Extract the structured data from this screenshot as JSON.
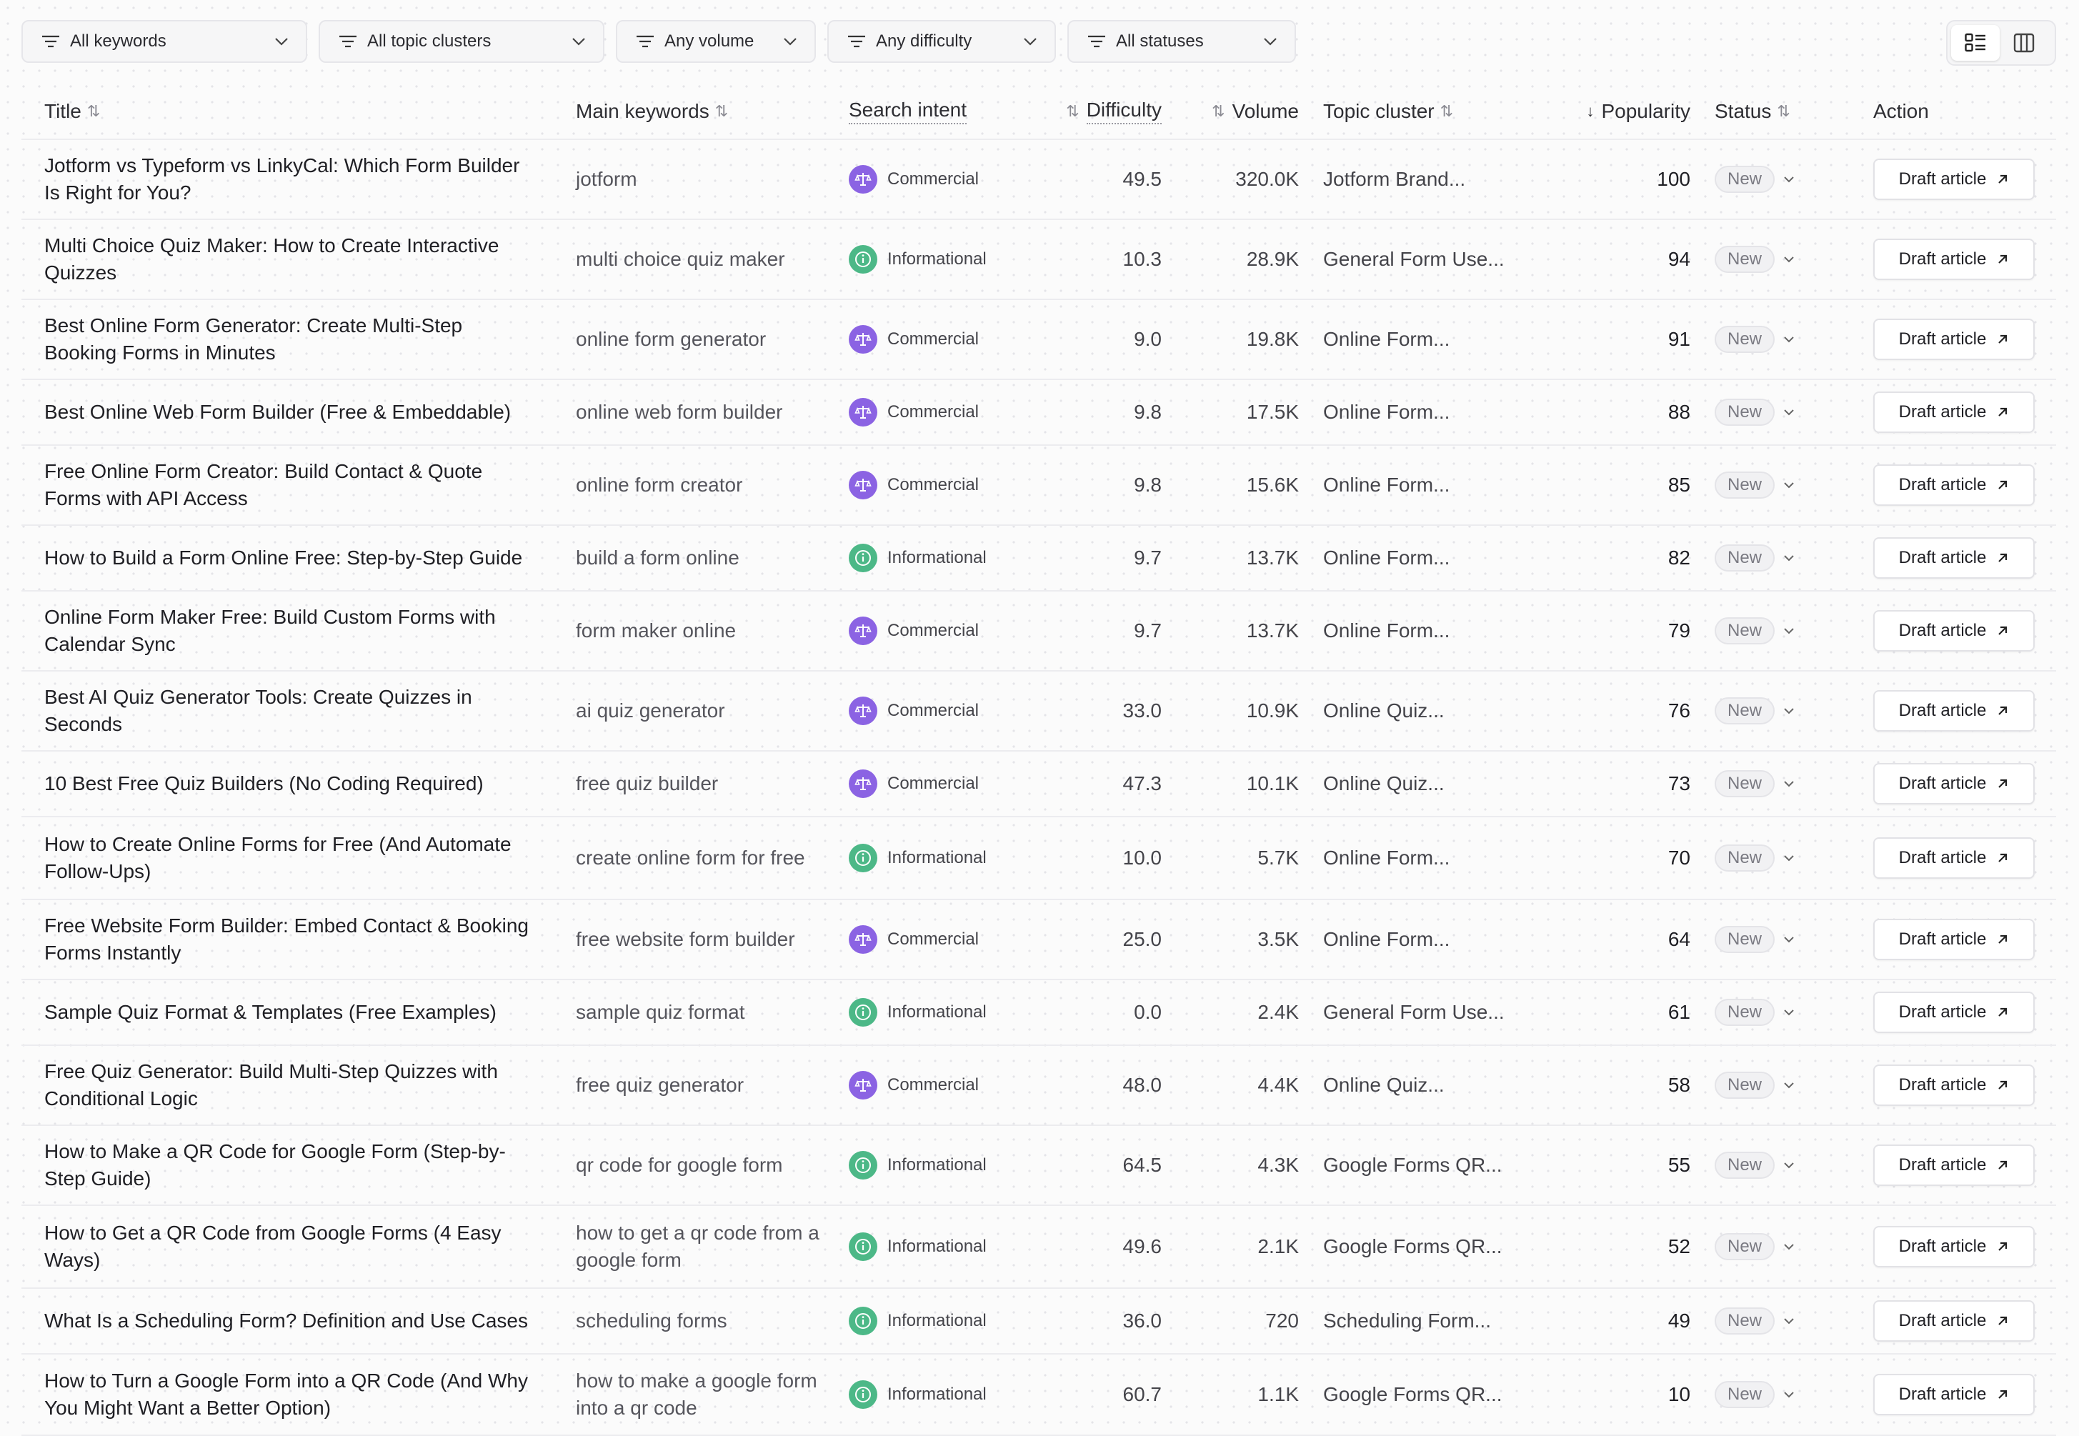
{
  "filters": [
    {
      "label": "All keywords",
      "icon": "filter-lines-icon"
    },
    {
      "label": "All topic clusters",
      "icon": "filter-lines-icon"
    },
    {
      "label": "Any volume",
      "icon": "filter-lines-icon"
    },
    {
      "label": "Any difficulty",
      "icon": "filter-lines-icon"
    },
    {
      "label": "All statuses",
      "icon": "filter-lines-icon"
    }
  ],
  "view_toggle": {
    "active": "list-view",
    "options": [
      "list-view-icon",
      "board-view-icon"
    ]
  },
  "columns": {
    "title": "Title",
    "main_keywords": "Main keywords",
    "search_intent": "Search intent",
    "difficulty": "Difficulty",
    "volume": "Volume",
    "topic_cluster": "Topic cluster",
    "popularity": "Popularity",
    "status": "Status",
    "action": "Action"
  },
  "rows": [
    {
      "title": "Jotform vs Typeform vs LinkyCal: Which Form Builder Is Right for You?",
      "keyword": "jotform",
      "intent": "Commercial",
      "difficulty": "49.5",
      "volume": "320.0K",
      "cluster": "Jotform Brand...",
      "popularity": "100",
      "status": "New",
      "action": "Draft article"
    },
    {
      "title": "Multi Choice Quiz Maker: How to Create Interactive Quizzes",
      "keyword": "multi choice quiz maker",
      "intent": "Informational",
      "difficulty": "10.3",
      "volume": "28.9K",
      "cluster": "General Form Use...",
      "popularity": "94",
      "status": "New",
      "action": "Draft article"
    },
    {
      "title": "Best Online Form Generator: Create Multi-Step Booking Forms in Minutes",
      "keyword": "online form generator",
      "intent": "Commercial",
      "difficulty": "9.0",
      "volume": "19.8K",
      "cluster": "Online Form...",
      "popularity": "91",
      "status": "New",
      "action": "Draft article"
    },
    {
      "title": "Best Online Web Form Builder (Free & Embeddable)",
      "keyword": "online web form builder",
      "intent": "Commercial",
      "difficulty": "9.8",
      "volume": "17.5K",
      "cluster": "Online Form...",
      "popularity": "88",
      "status": "New",
      "action": "Draft article"
    },
    {
      "title": "Free Online Form Creator: Build Contact & Quote Forms with API Access",
      "keyword": "online form creator",
      "intent": "Commercial",
      "difficulty": "9.8",
      "volume": "15.6K",
      "cluster": "Online Form...",
      "popularity": "85",
      "status": "New",
      "action": "Draft article"
    },
    {
      "title": "How to Build a Form Online Free: Step-by-Step Guide",
      "keyword": "build a form online",
      "intent": "Informational",
      "difficulty": "9.7",
      "volume": "13.7K",
      "cluster": "Online Form...",
      "popularity": "82",
      "status": "New",
      "action": "Draft article"
    },
    {
      "title": "Online Form Maker Free: Build Custom Forms with Calendar Sync",
      "keyword": "form maker online",
      "intent": "Commercial",
      "difficulty": "9.7",
      "volume": "13.7K",
      "cluster": "Online Form...",
      "popularity": "79",
      "status": "New",
      "action": "Draft article"
    },
    {
      "title": "Best AI Quiz Generator Tools: Create Quizzes in Seconds",
      "keyword": "ai quiz generator",
      "intent": "Commercial",
      "difficulty": "33.0",
      "volume": "10.9K",
      "cluster": "Online Quiz...",
      "popularity": "76",
      "status": "New",
      "action": "Draft article"
    },
    {
      "title": "10 Best Free Quiz Builders (No Coding Required)",
      "keyword": "free quiz builder",
      "intent": "Commercial",
      "difficulty": "47.3",
      "volume": "10.1K",
      "cluster": "Online Quiz...",
      "popularity": "73",
      "status": "New",
      "action": "Draft article"
    },
    {
      "title": "How to Create Online Forms for Free (And Automate Follow-Ups)",
      "keyword": "create online form for free",
      "intent": "Informational",
      "difficulty": "10.0",
      "volume": "5.7K",
      "cluster": "Online Form...",
      "popularity": "70",
      "status": "New",
      "action": "Draft article"
    },
    {
      "title": "Free Website Form Builder: Embed Contact & Booking Forms Instantly",
      "keyword": "free website form builder",
      "intent": "Commercial",
      "difficulty": "25.0",
      "volume": "3.5K",
      "cluster": "Online Form...",
      "popularity": "64",
      "status": "New",
      "action": "Draft article"
    },
    {
      "title": "Sample Quiz Format & Templates (Free Examples)",
      "keyword": "sample quiz format",
      "intent": "Informational",
      "difficulty": "0.0",
      "volume": "2.4K",
      "cluster": "General Form Use...",
      "popularity": "61",
      "status": "New",
      "action": "Draft article"
    },
    {
      "title": "Free Quiz Generator: Build Multi-Step Quizzes with Conditional Logic",
      "keyword": "free quiz generator",
      "intent": "Commercial",
      "difficulty": "48.0",
      "volume": "4.4K",
      "cluster": "Online Quiz...",
      "popularity": "58",
      "status": "New",
      "action": "Draft article"
    },
    {
      "title": "How to Make a QR Code for Google Form (Step-by-Step Guide)",
      "keyword": "qr code for google form",
      "intent": "Informational",
      "difficulty": "64.5",
      "volume": "4.3K",
      "cluster": "Google Forms QR...",
      "popularity": "55",
      "status": "New",
      "action": "Draft article"
    },
    {
      "title": "How to Get a QR Code from Google Forms (4 Easy Ways)",
      "keyword": "how to get a qr code from a google form",
      "intent": "Informational",
      "difficulty": "49.6",
      "volume": "2.1K",
      "cluster": "Google Forms QR...",
      "popularity": "52",
      "status": "New",
      "action": "Draft article"
    },
    {
      "title": "What Is a Scheduling Form? Definition and Use Cases",
      "keyword": "scheduling forms",
      "intent": "Informational",
      "difficulty": "36.0",
      "volume": "720",
      "cluster": "Scheduling Form...",
      "popularity": "49",
      "status": "New",
      "action": "Draft article"
    },
    {
      "title": "How to Turn a Google Form into a QR Code (And Why You Might Want a Better Option)",
      "keyword": "how to make a google form into a qr code",
      "intent": "Informational",
      "difficulty": "60.7",
      "volume": "1.1K",
      "cluster": "Google Forms QR...",
      "popularity": "10",
      "status": "New",
      "action": "Draft article"
    }
  ],
  "colors": {
    "commercial": "#8b63e3",
    "informational": "#4cb887"
  }
}
